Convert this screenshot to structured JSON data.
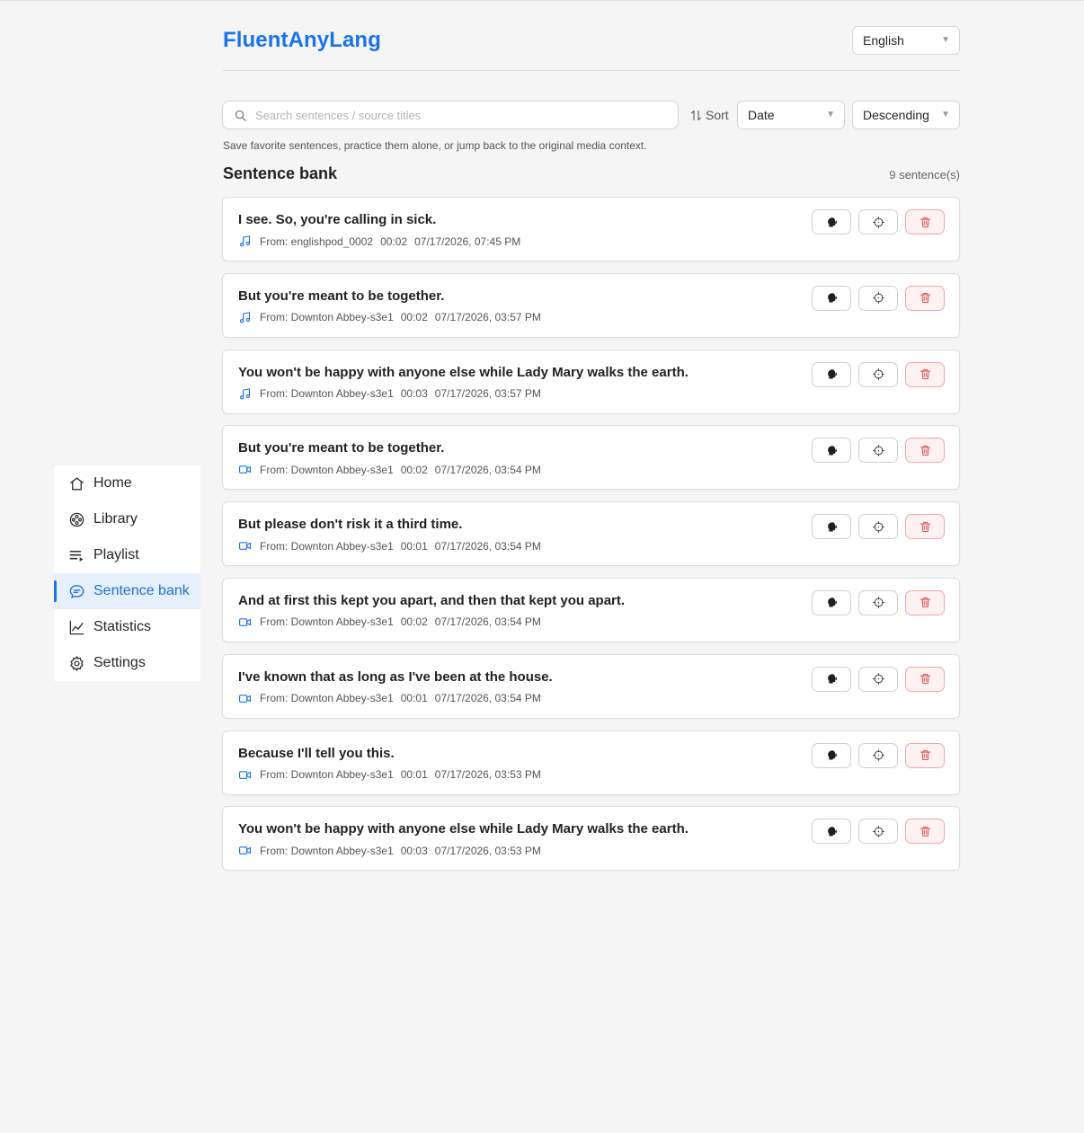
{
  "app": {
    "title": "FluentAnyLang",
    "language": "English"
  },
  "sidebar": {
    "items": [
      {
        "label": "Home",
        "icon": "home-icon"
      },
      {
        "label": "Library",
        "icon": "film-reel-icon"
      },
      {
        "label": "Playlist",
        "icon": "playlist-icon"
      },
      {
        "label": "Sentence bank",
        "icon": "chat-bubble-icon",
        "active": true
      },
      {
        "label": "Statistics",
        "icon": "line-chart-icon"
      },
      {
        "label": "Settings",
        "icon": "gear-icon"
      }
    ]
  },
  "toolbar": {
    "search_placeholder": "Search sentences / source titles",
    "sort_label": "Sort",
    "sort_field": "Date",
    "sort_order": "Descending"
  },
  "hint": "Save favorite sentences, practice them alone, or jump back to the original media context.",
  "section": {
    "title": "Sentence bank",
    "count": "9 sentence(s)"
  },
  "colors": {
    "accent": "#1a73e8",
    "danger": "#e05555",
    "background": "#f5f5f5"
  },
  "sentences": [
    {
      "text": "I see. So, you're calling in sick.",
      "media": "audio",
      "from": "From: englishpod_0002",
      "time": "00:02",
      "date": "07/17/2026, 07:45 PM"
    },
    {
      "text": "But you're meant to be together.",
      "media": "audio",
      "from": "From: Downton Abbey-s3e1",
      "time": "00:02",
      "date": "07/17/2026, 03:57 PM"
    },
    {
      "text": "You won't be happy with anyone else while Lady Mary walks the earth.",
      "media": "audio",
      "from": "From: Downton Abbey-s3e1",
      "time": "00:03",
      "date": "07/17/2026, 03:57 PM"
    },
    {
      "text": "But you're meant to be together.",
      "media": "video",
      "from": "From: Downton Abbey-s3e1",
      "time": "00:02",
      "date": "07/17/2026, 03:54 PM"
    },
    {
      "text": "But please don't risk it a third time.",
      "media": "video",
      "from": "From: Downton Abbey-s3e1",
      "time": "00:01",
      "date": "07/17/2026, 03:54 PM"
    },
    {
      "text": "And at first this kept you apart, and then that kept you apart.",
      "media": "video",
      "from": "From: Downton Abbey-s3e1",
      "time": "00:02",
      "date": "07/17/2026, 03:54 PM"
    },
    {
      "text": "I've known that as long as I've been at the house.",
      "media": "video",
      "from": "From: Downton Abbey-s3e1",
      "time": "00:01",
      "date": "07/17/2026, 03:54 PM"
    },
    {
      "text": "Because I'll tell you this.",
      "media": "video",
      "from": "From: Downton Abbey-s3e1",
      "time": "00:01",
      "date": "07/17/2026, 03:53 PM"
    },
    {
      "text": "You won't be happy with anyone else while Lady Mary walks the earth.",
      "media": "video",
      "from": "From: Downton Abbey-s3e1",
      "time": "00:03",
      "date": "07/17/2026, 03:53 PM"
    }
  ]
}
